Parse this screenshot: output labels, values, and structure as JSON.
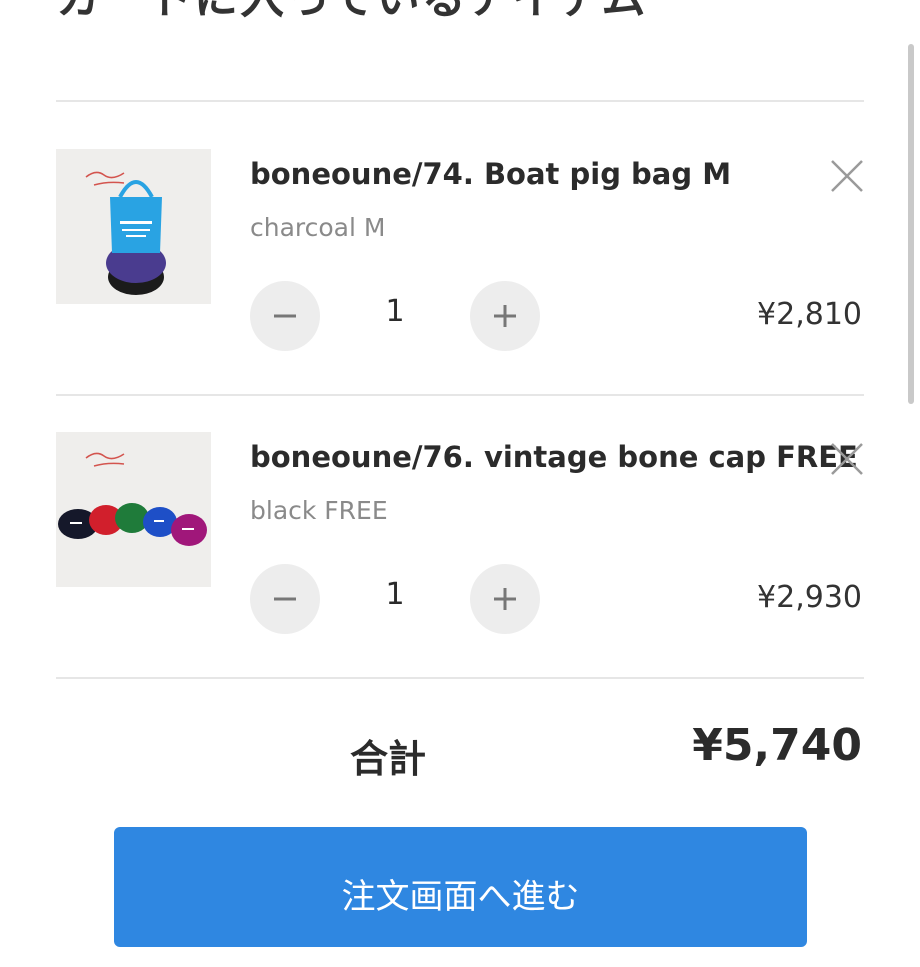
{
  "page": {
    "title": "カートに入っているアイテム"
  },
  "items": [
    {
      "name": "boneoune/74. Boat pig bag M",
      "variant": "charcoal M",
      "quantity": "1",
      "price": "¥2,810",
      "thumbnail_icon": "tote-bag-image"
    },
    {
      "name": "boneoune/76. vintage bone cap FREE",
      "variant": "black FREE",
      "quantity": "1",
      "price": "¥2,930",
      "thumbnail_icon": "caps-image"
    }
  ],
  "summary": {
    "total_label": "合計",
    "total_value": "¥5,740"
  },
  "checkout": {
    "label": "注文画面へ進む"
  },
  "colors": {
    "accent": "#2f87e1",
    "divider": "#e6e6e6",
    "button_bg": "#ededed"
  }
}
